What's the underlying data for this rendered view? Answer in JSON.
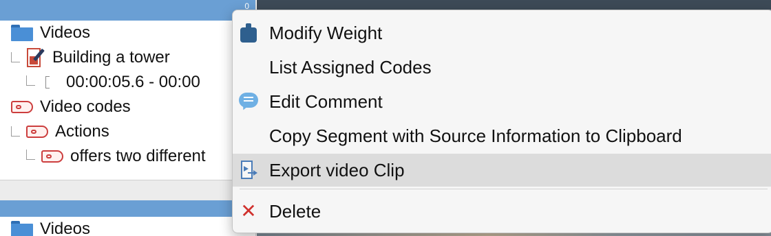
{
  "tree_top": {
    "header_mark": "0",
    "items": [
      {
        "label": "Videos",
        "icon": "folder-icon"
      },
      {
        "label": "Building a tower",
        "icon": "video-document-icon"
      },
      {
        "label": "00:00:05.6 - 00:00",
        "icon": "segment-icon"
      },
      {
        "label": "Video codes",
        "icon": "code-tag-icon"
      },
      {
        "label": "Actions",
        "icon": "code-tag-icon"
      },
      {
        "label": "offers two different",
        "icon": "code-tag-icon"
      }
    ]
  },
  "tree_bottom": {
    "items": [
      {
        "label": "Videos",
        "icon": "folder-icon"
      }
    ]
  },
  "context_menu": {
    "items": [
      {
        "label": "Modify Weight",
        "icon": "weight-icon"
      },
      {
        "label": "List Assigned Codes",
        "icon": ""
      },
      {
        "label": "Edit Comment",
        "icon": "comment-icon"
      },
      {
        "label": "Copy Segment with Source Information to Clipboard",
        "icon": ""
      },
      {
        "label": "Export video Clip",
        "icon": "export-clip-icon",
        "highlighted": true
      },
      {
        "label": "Delete",
        "icon": "delete-icon"
      }
    ]
  },
  "colors": {
    "header_bar": "#6a9fd4",
    "folder": "#4a8fd6",
    "code_tag": "#cc3d3d",
    "menu_highlight": "#dcdcdc",
    "delete": "#d0312d"
  }
}
